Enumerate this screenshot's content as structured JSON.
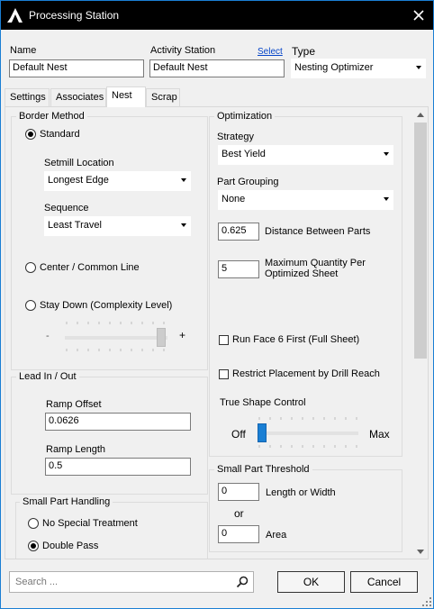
{
  "window": {
    "title": "Processing Station"
  },
  "header": {
    "name_label": "Name",
    "name_value": "Default Nest",
    "activity_label": "Activity Station",
    "select_link": "Select",
    "activity_value": "Default Nest",
    "type_label": "Type",
    "type_value": "Nesting Optimizer"
  },
  "tabs": [
    {
      "label": "Settings"
    },
    {
      "label": "Associates"
    },
    {
      "label": "Nest"
    },
    {
      "label": "Scrap"
    }
  ],
  "border_method": {
    "title": "Border Method",
    "standard_label": "Standard",
    "standard_selected": true,
    "setmill_label": "Setmill Location",
    "setmill_value": "Longest Edge",
    "sequence_label": "Sequence",
    "sequence_value": "Least Travel",
    "center_label": "Center / Common Line",
    "staydown_label": "Stay Down (Complexity Level)",
    "slider_minus": "-",
    "slider_plus": "+",
    "complexity_level": 1.0
  },
  "lead_in_out": {
    "title": "Lead In / Out",
    "ramp_offset_label": "Ramp Offset",
    "ramp_offset_value": "0.0626",
    "ramp_length_label": "Ramp Length",
    "ramp_length_value": "0.5"
  },
  "small_part_handling": {
    "title": "Small Part Handling",
    "no_special_label": "No Special Treatment",
    "double_pass_label": "Double Pass",
    "double_pass_selected": true
  },
  "optimization": {
    "title": "Optimization",
    "strategy_label": "Strategy",
    "strategy_value": "Best Yield",
    "part_grouping_label": "Part Grouping",
    "part_grouping_value": "None",
    "distance_value": "0.625",
    "distance_label": "Distance Between Parts",
    "max_qty_value": "5",
    "max_qty_label_line1": "Maximum Quantity Per",
    "max_qty_label_line2": "Optimized Sheet",
    "run_face6_label": "Run Face 6 First (Full Sheet)",
    "run_face6_checked": false,
    "restrict_label": "Restrict Placement by Drill Reach",
    "restrict_checked": false,
    "true_shape_label": "True Shape Control",
    "off_label": "Off",
    "max_label": "Max",
    "true_shape_level": 0.0
  },
  "small_part_threshold": {
    "title": "Small Part Threshold",
    "length_value": "0",
    "length_label": "Length or Width",
    "or_label": "or",
    "area_value": "0",
    "area_label": "Area"
  },
  "footer": {
    "search_placeholder": "Search ...",
    "ok_label": "OK",
    "cancel_label": "Cancel"
  },
  "colors": {
    "accent": "#1a7fd4",
    "titlebar": "#000000",
    "link": "#0645c8"
  }
}
